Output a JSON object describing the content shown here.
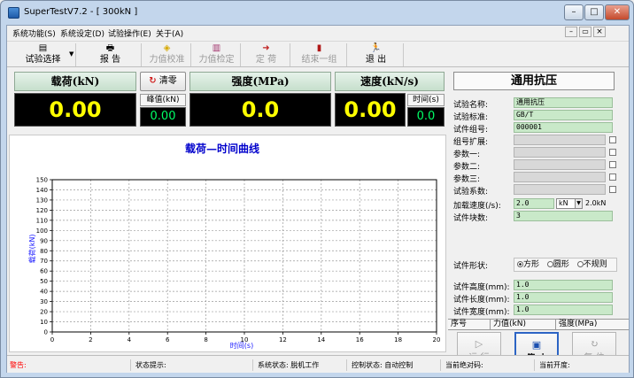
{
  "window": {
    "title": "SuperTestV7.2 - [ 300kN ]",
    "controls": {
      "minimize": "–",
      "maximize": "□",
      "close": "✕"
    },
    "inner_controls": {
      "minimize": "–",
      "restore": "▭",
      "close": "×"
    }
  },
  "menu": [
    "系统功能(S)",
    "系统设定(D)",
    "试验操作(E)",
    "关于(A)"
  ],
  "toolbar": [
    {
      "label": "试验选择",
      "icon": "test-select-icon",
      "glyph": "▤",
      "enabled": true
    },
    {
      "label": "报  告",
      "icon": "report-icon",
      "glyph": "🖶",
      "enabled": true
    },
    {
      "label": "力值校准",
      "icon": "force-calibrate-icon",
      "glyph": "◈",
      "enabled": false
    },
    {
      "label": "力值检定",
      "icon": "force-verify-icon",
      "glyph": "▥",
      "enabled": false
    },
    {
      "label": "定  荷",
      "icon": "hold-load-icon",
      "glyph": "➜",
      "enabled": false
    },
    {
      "label": "结束一组",
      "icon": "end-group-icon",
      "glyph": "▮",
      "enabled": false
    },
    {
      "label": "退  出",
      "icon": "exit-icon",
      "glyph": "🏃",
      "enabled": true
    }
  ],
  "readouts": {
    "load": {
      "header": "载荷(kN)",
      "value": "0.00"
    },
    "zero_button": "清零",
    "peak": {
      "label": "峰值(kN)",
      "value": "0.00"
    },
    "strength": {
      "header": "强度(MPa)",
      "value": "0.0"
    },
    "speed": {
      "header": "速度(kN/s)",
      "value": "0.00"
    },
    "time": {
      "label": "时间(s)",
      "value": "0.0"
    }
  },
  "chart_data": {
    "type": "line",
    "title": "载荷—时间曲线",
    "xlabel": "时间(s)",
    "ylabel": "载荷(kN)",
    "xlim": [
      0,
      20
    ],
    "ylim": [
      0,
      150
    ],
    "x_ticks": [
      0,
      2,
      4,
      6,
      8,
      10,
      12,
      14,
      16,
      18,
      20
    ],
    "y_ticks": [
      0,
      10,
      20,
      30,
      40,
      50,
      60,
      70,
      80,
      90,
      100,
      110,
      120,
      130,
      140,
      150
    ],
    "grid": true,
    "series": []
  },
  "panel": {
    "title": "通用抗压",
    "fields": [
      {
        "label": "试验名称:",
        "value": "通用抗压",
        "enabled": true,
        "checkbox": false
      },
      {
        "label": "试验标准:",
        "value": "GB/T",
        "enabled": true,
        "checkbox": false
      },
      {
        "label": "试件组号:",
        "value": "000001",
        "enabled": true,
        "checkbox": false
      },
      {
        "label": "组号扩展:",
        "value": "",
        "enabled": false,
        "checkbox": true
      },
      {
        "label": "参数一:",
        "value": "",
        "enabled": false,
        "checkbox": true
      },
      {
        "label": "参数二:",
        "value": "",
        "enabled": false,
        "checkbox": true
      },
      {
        "label": "参数三:",
        "value": "",
        "enabled": false,
        "checkbox": true
      },
      {
        "label": "试验系数:",
        "value": "",
        "enabled": false,
        "checkbox": true
      }
    ],
    "speed": {
      "label": "加载速度(/s):",
      "value": "2.0",
      "unit": "kN",
      "max": "2.0kN"
    },
    "count": {
      "label": "试件块数:",
      "value": "3"
    },
    "shape": {
      "label": "试件形状:",
      "options": [
        "方形",
        "圆形",
        "不规则"
      ],
      "selected": "方形"
    },
    "dims": [
      {
        "label": "试件高度(mm):",
        "value": "1.0"
      },
      {
        "label": "试件长度(mm):",
        "value": "1.0"
      },
      {
        "label": "试件宽度(mm):",
        "value": "1.0"
      }
    ],
    "results_columns": [
      "序号",
      "力值(kN)",
      "强度(MPa)"
    ],
    "controls": [
      {
        "label": "运 行",
        "icon": "run-icon",
        "glyph": "▷",
        "enabled": false
      },
      {
        "label": "停 止",
        "icon": "stop-icon",
        "glyph": "▣",
        "enabled": true
      },
      {
        "label": "复 位",
        "icon": "reset-icon",
        "glyph": "↻",
        "enabled": false
      }
    ]
  },
  "status": {
    "alarm": "警告:",
    "hint": "状态提示:",
    "system": "系统状态: 脱机工作",
    "control": "控制状态: 自动控制",
    "abs_pos": "当前绝对码:",
    "opening": "当前开度:"
  },
  "colors": {
    "alarm": "#ff0000",
    "readout_big": "#ffff00",
    "readout_small": "#00ff66",
    "chart_title": "#0000cc",
    "axis_label": "#1a1aff",
    "field_active": "#c9e9c9",
    "field_disabled": "#d8d8d8"
  }
}
